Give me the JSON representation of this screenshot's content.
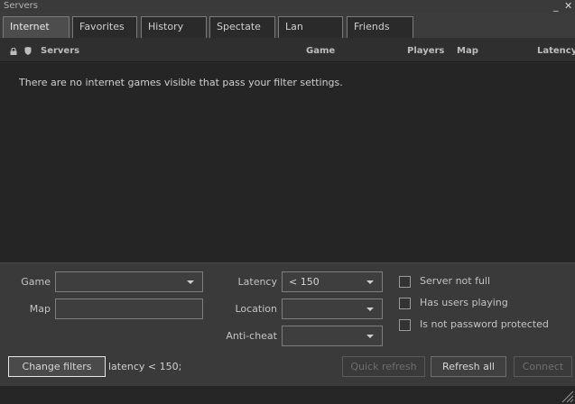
{
  "window": {
    "title": "Servers",
    "minimize": "_",
    "close": "✕"
  },
  "tabs": [
    {
      "label": "Internet",
      "active": true
    },
    {
      "label": "Favorites"
    },
    {
      "label": "History"
    },
    {
      "label": "Spectate"
    },
    {
      "label": "Lan"
    },
    {
      "label": "Friends"
    }
  ],
  "columns": {
    "servers": "Servers",
    "game": "Game",
    "players": "Players",
    "map": "Map",
    "latency": "Latency"
  },
  "list": {
    "empty_message": "There are no internet games visible that pass your filter settings."
  },
  "filters": {
    "game_label": "Game",
    "game_value": "",
    "map_label": "Map",
    "map_value": "",
    "latency_label": "Latency",
    "latency_value": "< 150",
    "location_label": "Location",
    "location_value": "",
    "anticheat_label": "Anti-cheat",
    "anticheat_value": "",
    "server_not_full": "Server not full",
    "has_users_playing": "Has users playing",
    "not_password_protected": "Is not password protected"
  },
  "actions": {
    "change_filters": "Change filters",
    "filter_summary": "latency < 150;",
    "quick_refresh": "Quick refresh",
    "refresh_all": "Refresh all",
    "connect": "Connect"
  },
  "icons": {
    "lock": "lock-icon",
    "shield": "shield-icon",
    "resize": "resize-grip-icon"
  }
}
